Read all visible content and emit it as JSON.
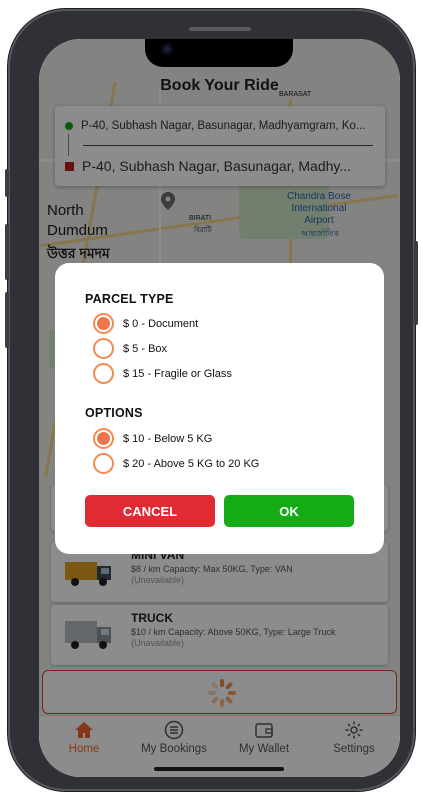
{
  "header": {
    "title": "Book Your Ride"
  },
  "addresses": {
    "pickup": "P-40, Subhash Nagar, Basunagar, Madhyamgram, Ko...",
    "drop": "P-40, Subhash Nagar, Basunagar, Madhy..."
  },
  "map_labels": {
    "north_dumdum": "North\nDumdum",
    "north_dumdum_bn": "উত্তর দমদম",
    "birati": "BIRATI",
    "birati_bn": "বিরাটি",
    "airport": "Chandra Bose\nInternational\nAirport",
    "airport_bn": "আন্তর্জাতিক",
    "barasat": "BARASAT"
  },
  "dialog": {
    "parcel_type_title": "PARCEL TYPE",
    "parcel_options": [
      {
        "label": "$ 0 - Document",
        "selected": true
      },
      {
        "label": "$ 5 - Box",
        "selected": false
      },
      {
        "label": "$ 15 - Fragile or Glass",
        "selected": false
      }
    ],
    "options_title": "OPTIONS",
    "weight_options": [
      {
        "label": "$ 10 - Below 5 KG",
        "selected": true
      },
      {
        "label": "$ 20 - Above 5 KG to 20 KG",
        "selected": false
      }
    ],
    "cancel_label": "CANCEL",
    "ok_label": "OK"
  },
  "vehicles": [
    {
      "name": "MINI VAN",
      "desc": "$8 / km  Capacity: Max 50KG, Type: VAN",
      "status": "(Unavailable)"
    },
    {
      "name": "TRUCK",
      "desc": "$10 / km  Capacity: Above 50KG, Type: Large Truck",
      "status": "(Unavailable)"
    }
  ],
  "nav": {
    "home": "Home",
    "bookings": "My Bookings",
    "wallet": "My Wallet",
    "settings": "Settings"
  },
  "colors": {
    "accent": "#f0652b",
    "radio": "#f28a52",
    "cancel": "#e02a34",
    "ok": "#14ab14"
  }
}
